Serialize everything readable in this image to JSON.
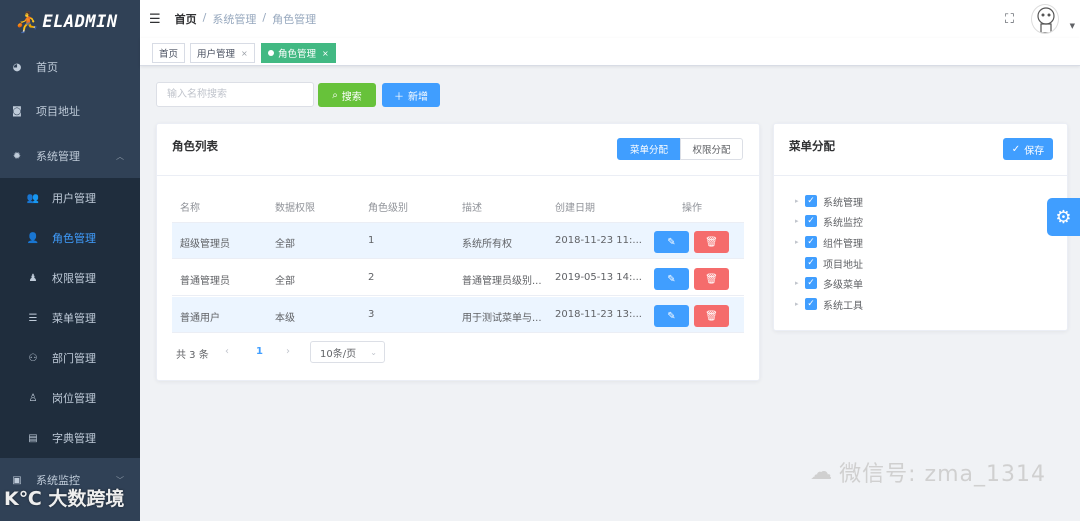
{
  "app": {
    "logo_mark": "⛹",
    "logo_text": "ELADMIN"
  },
  "sidebar": {
    "items": [
      {
        "label": "首页",
        "icon": "dashboard-icon"
      },
      {
        "label": "项目地址",
        "icon": "github-icon"
      },
      {
        "label": "系统管理",
        "icon": "gear-icon",
        "arrow": "︿"
      },
      {
        "label": "用户管理",
        "icon": "users-icon"
      },
      {
        "label": "角色管理",
        "icon": "user-role-icon"
      },
      {
        "label": "权限管理",
        "icon": "permission-icon"
      },
      {
        "label": "菜单管理",
        "icon": "menu-icon"
      },
      {
        "label": "部门管理",
        "icon": "dept-icon"
      },
      {
        "label": "岗位管理",
        "icon": "job-icon"
      },
      {
        "label": "字典管理",
        "icon": "dict-icon"
      },
      {
        "label": "系统监控",
        "icon": "monitor-icon",
        "arrow": "﹀"
      }
    ]
  },
  "header": {
    "breadcrumb": [
      "首页",
      "/",
      "系统管理",
      "/",
      "角色管理"
    ]
  },
  "tags": [
    {
      "label": "首页"
    },
    {
      "label": "用户管理",
      "close": "×"
    },
    {
      "label": "角色管理",
      "close": "×"
    }
  ],
  "toolbar": {
    "search_placeholder": "输入名称搜索",
    "search_label": "搜索",
    "add_label": "新增"
  },
  "roles_card": {
    "title": "角色列表",
    "seg_menu": "菜单分配",
    "seg_perm": "权限分配",
    "columns": [
      "名称",
      "数据权限",
      "角色级别",
      "描述",
      "创建日期",
      "操作"
    ],
    "rows": [
      {
        "name": "超级管理员",
        "scope": "全部",
        "level": "1",
        "desc": "系统所有权",
        "created": "2018-11-23 11:..."
      },
      {
        "name": "普通管理员",
        "scope": "全部",
        "level": "2",
        "desc": "普通管理员级别...",
        "created": "2019-05-13 14:..."
      },
      {
        "name": "普通用户",
        "scope": "本级",
        "level": "3",
        "desc": "用于测试菜单与...",
        "created": "2018-11-23 13:..."
      }
    ],
    "pagination": {
      "total": "共 3 条",
      "prev": "‹",
      "page": "1",
      "next": "›",
      "size": "10条/页",
      "size_arrow": "⌄"
    }
  },
  "menu_card": {
    "title": "菜单分配",
    "save_label": "保存",
    "nodes": [
      {
        "label": "系统管理",
        "arrow": "▸"
      },
      {
        "label": "系统监控",
        "arrow": "▸"
      },
      {
        "label": "组件管理",
        "arrow": "▸"
      },
      {
        "label": "项目地址",
        "arrow": ""
      },
      {
        "label": "多级菜单",
        "arrow": "▸"
      },
      {
        "label": "系统工具",
        "arrow": "▸"
      }
    ]
  },
  "watermark": {
    "text": "微信号: zma_1314",
    "logo_text": "K℃ 大数跨境"
  },
  "colors": {
    "sidebar": "#304156",
    "primary": "#409eff",
    "success": "#67c23a",
    "danger": "#f56c6c",
    "tag_active": "#42b983"
  }
}
